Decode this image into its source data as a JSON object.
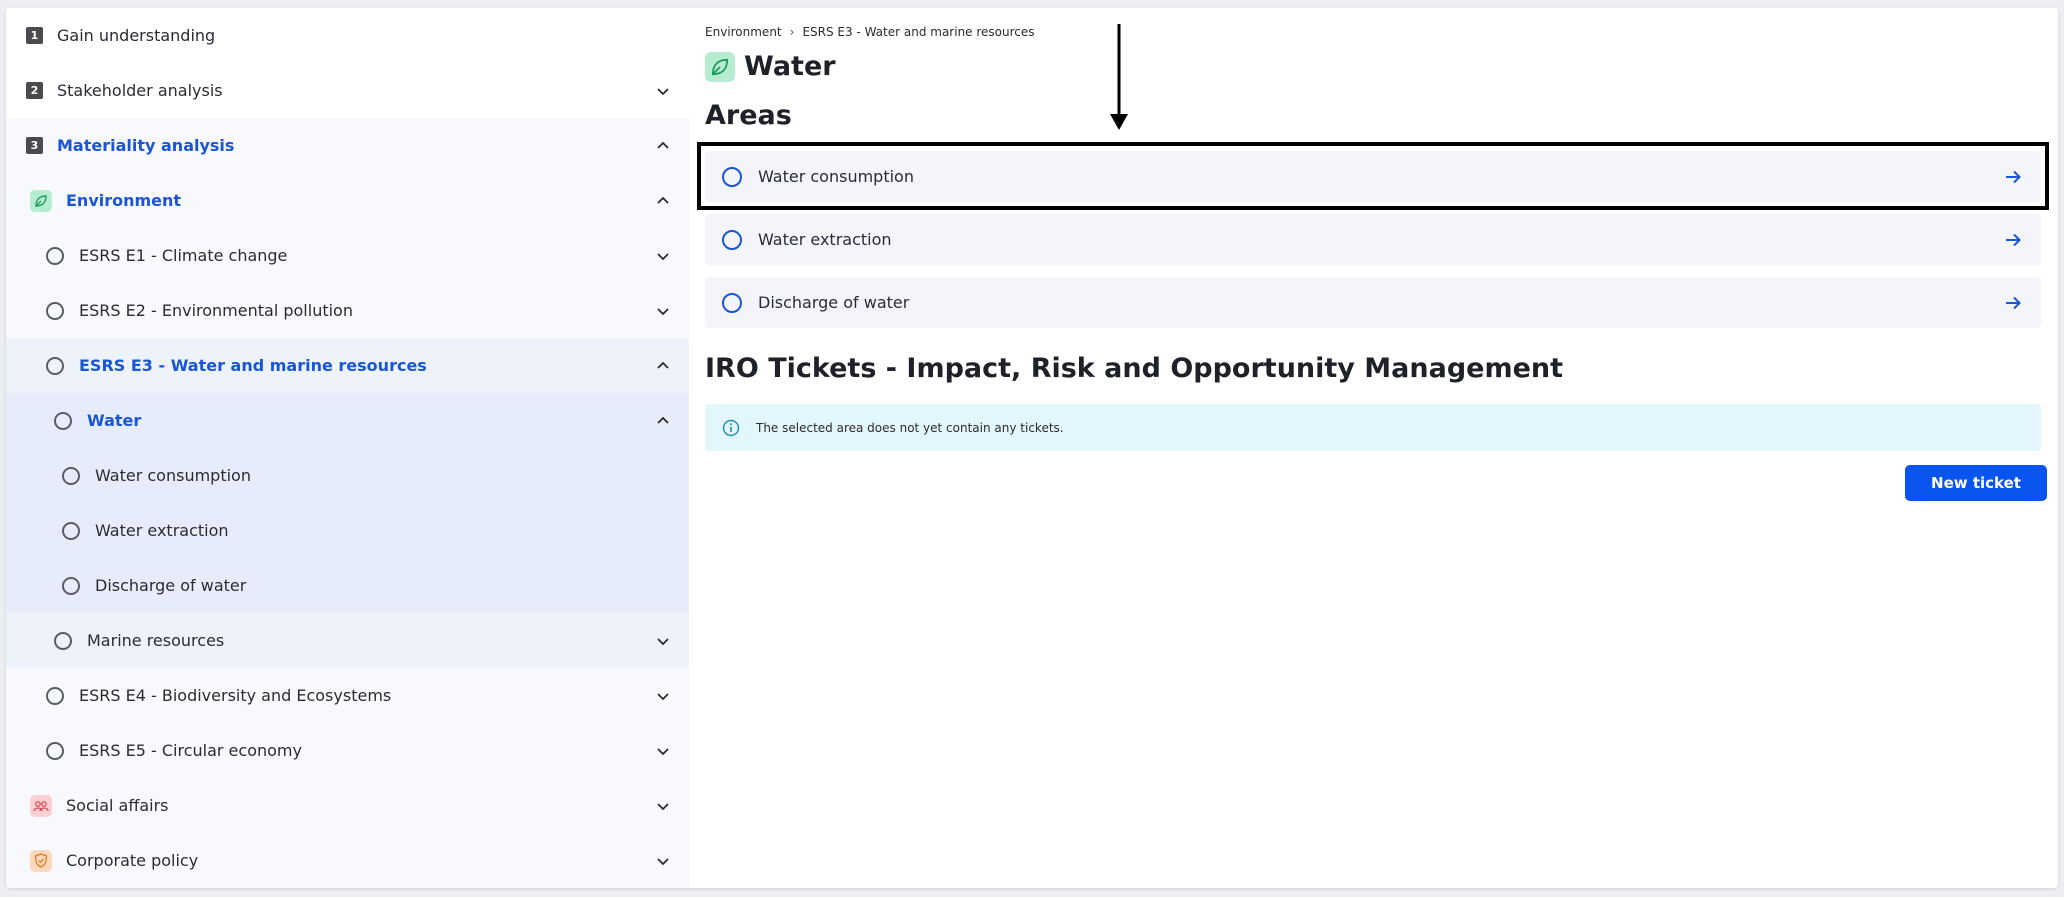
{
  "sidebar": {
    "steps": [
      {
        "number": "1",
        "label": "Gain understanding"
      },
      {
        "number": "2",
        "label": "Stakeholder analysis"
      },
      {
        "number": "3",
        "label": "Materiality analysis"
      }
    ],
    "categories": {
      "environment": "Environment",
      "social": "Social affairs",
      "corporate": "Corporate policy"
    },
    "topics": {
      "e1": "ESRS E1 - Climate change",
      "e2": "ESRS E2 - Environmental pollution",
      "e3": "ESRS E3 - Water and marine resources",
      "e4": "ESRS E4 - Biodiversity and Ecosystems",
      "e5": "ESRS E5 - Circular economy"
    },
    "subtopics": {
      "water": "Water",
      "marine": "Marine resources"
    },
    "areas": [
      "Water consumption",
      "Water extraction",
      "Discharge of water"
    ]
  },
  "main": {
    "breadcrumb": [
      "Environment",
      "ESRS E3 - Water and marine resources"
    ],
    "breadcrumb_separator": "›",
    "title": "Water",
    "areas_heading": "Areas",
    "areas": [
      "Water consumption",
      "Water extraction",
      "Discharge of water"
    ],
    "iro_heading": "IRO Tickets - Impact, Risk and Opportunity Management",
    "info_text": "The selected area does not yet contain any tickets.",
    "new_ticket_label": "New ticket"
  },
  "colors": {
    "accent": "#1a55d6",
    "button": "#0a55f0",
    "nav_level1": "#f7f9fd",
    "nav_level2": "#eef2fb",
    "nav_level3": "#e6ecfa",
    "info_bg": "#e3f6fb"
  }
}
